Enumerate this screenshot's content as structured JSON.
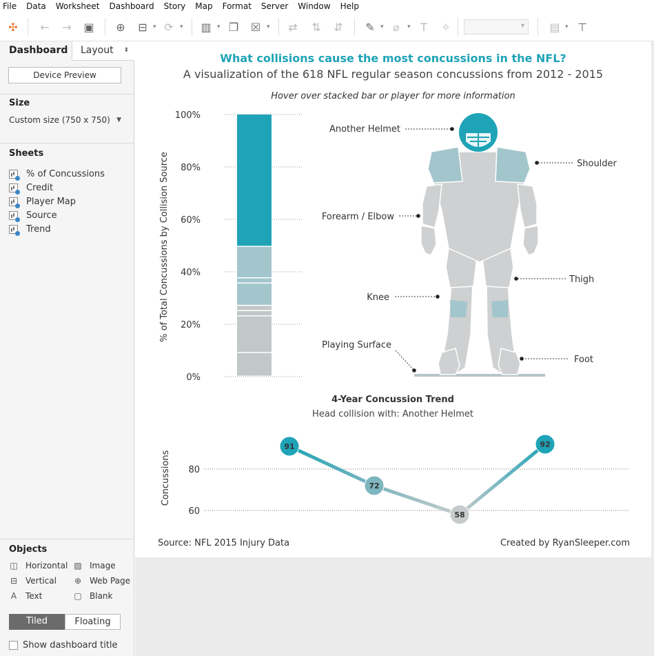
{
  "menu": [
    "File",
    "Data",
    "Worksheet",
    "Dashboard",
    "Story",
    "Map",
    "Format",
    "Server",
    "Window",
    "Help"
  ],
  "side": {
    "tab_dashboard": "Dashboard",
    "tab_layout": "Layout",
    "device_preview": "Device Preview",
    "size_title": "Size",
    "size_value": "Custom size (750 x 750)",
    "sheets_title": "Sheets",
    "sheets": [
      "% of Concussions",
      "Credit",
      "Player Map",
      "Source",
      "Trend"
    ],
    "objects_title": "Objects",
    "objects": [
      "Horizontal",
      "Image",
      "Vertical",
      "Web Page",
      "Text",
      "Blank"
    ],
    "tiled": "Tiled",
    "floating": "Floating",
    "show_title": "Show dashboard title"
  },
  "dashboard": {
    "title": "What collisions cause the most concussions in the NFL?",
    "subtitle": "A visualization of the 618 NFL regular season concussions from 2012 - 2015",
    "hint": "Hover over stacked bar or player for more information",
    "source": "Source: NFL 2015 Injury Data",
    "credit": "Created by RyanSleeper.com"
  },
  "player_labels": {
    "helmet": "Another Helmet",
    "shoulder": "Shoulder",
    "forearm": "Forearm / Elbow",
    "thigh": "Thigh",
    "knee": "Knee",
    "surface": "Playing Surface",
    "foot": "Foot"
  },
  "colors": {
    "accent": "#1fa3b7",
    "light_teal": "#a3c6cc",
    "gray": "#c2c7c9",
    "player": "#cfd0d1"
  },
  "chart_data": [
    {
      "type": "bar",
      "stacked": true,
      "ylabel": "% of Total Concussions by Collision Source",
      "ylim": [
        0,
        100
      ],
      "ticks": [
        "0%",
        "20%",
        "40%",
        "60%",
        "80%",
        "100%"
      ],
      "segments": [
        {
          "label": "Playing Surface",
          "pct": 9,
          "color": "#c2c7c9"
        },
        {
          "label": "Foot",
          "pct": 14,
          "color": "#c2c7c9"
        },
        {
          "label": "Knee",
          "pct": 2,
          "color": "#c2c7c9"
        },
        {
          "label": "Thigh",
          "pct": 2,
          "color": "#c2c7c9"
        },
        {
          "label": "Forearm / Elbow",
          "pct": 8.5,
          "color": "#a3c6cc"
        },
        {
          "label": "Shoulder",
          "pct": 2,
          "color": "#a3c6cc"
        },
        {
          "label": "Shoulder-2",
          "pct": 12,
          "color": "#a3c6cc"
        },
        {
          "label": "Another Helmet",
          "pct": 50.5,
          "color": "#1fa3b7"
        }
      ]
    },
    {
      "type": "line",
      "title": "4-Year Concussion Trend",
      "subtitle": "Head collision with: Another Helmet",
      "ylabel": "Concussions",
      "y_ticks": [
        60,
        80
      ],
      "ylim": [
        55,
        95
      ],
      "values": [
        91,
        72,
        58,
        92
      ],
      "point_colors": [
        "#1fa3b7",
        "#7eb6bf",
        "#c8cbcc",
        "#1fa3b7"
      ]
    }
  ]
}
